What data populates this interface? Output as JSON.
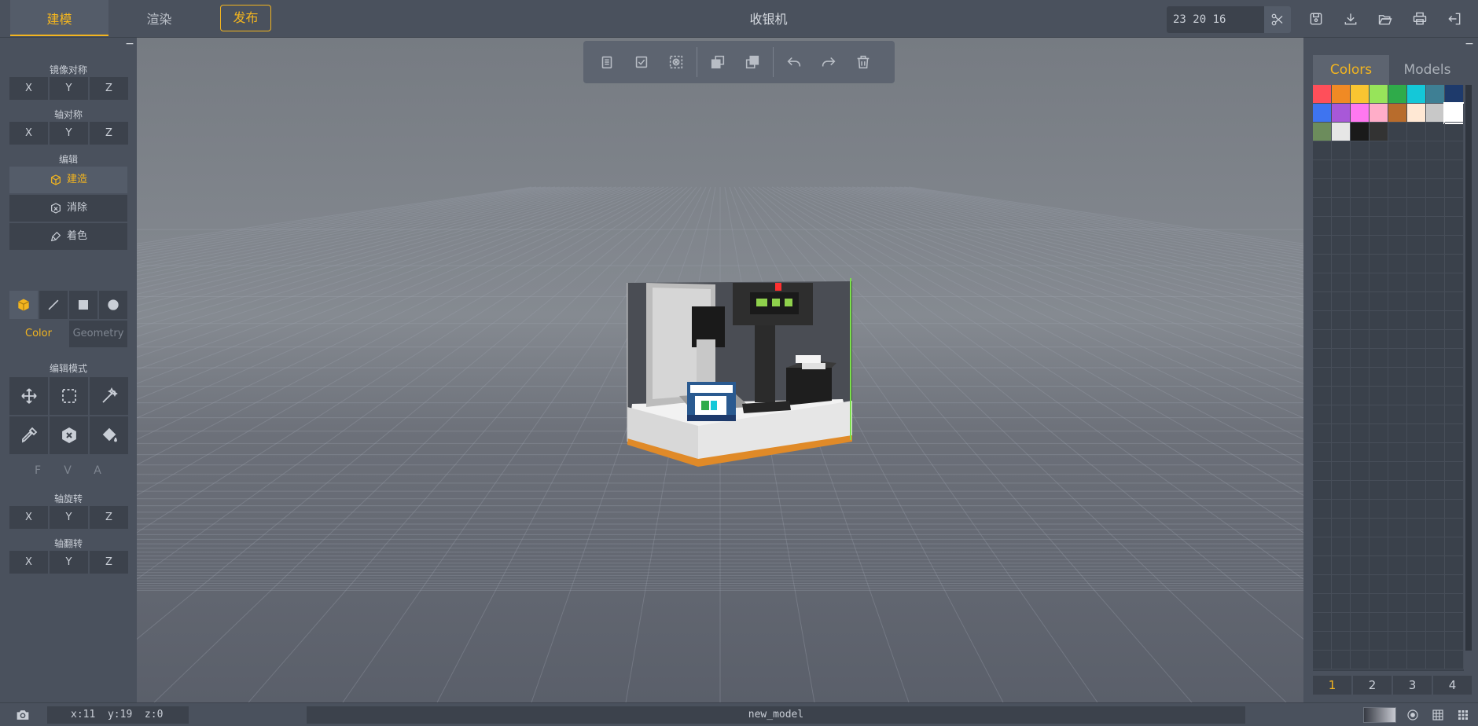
{
  "header": {
    "tabs": [
      {
        "label": "建模",
        "active": true
      },
      {
        "label": "渲染",
        "active": false
      }
    ],
    "publish_label": "发布",
    "title": "收银机",
    "dimensions_value": "23 20 16",
    "icons": [
      "scissors-icon",
      "save-icon",
      "download-icon",
      "folder-open-icon",
      "print-icon",
      "exit-icon"
    ]
  },
  "left": {
    "mirror_label": "镜像对称",
    "mirror_axes": [
      "X",
      "Y",
      "Z"
    ],
    "axis_sym_label": "轴对称",
    "axis_sym_axes": [
      "X",
      "Y",
      "Z"
    ],
    "edit_label": "编辑",
    "tools": [
      {
        "label": "建造",
        "icon": "build-icon",
        "active": true
      },
      {
        "label": "消除",
        "icon": "erase-icon",
        "active": false
      },
      {
        "label": "着色",
        "icon": "paint-brush-icon",
        "active": false
      }
    ],
    "shapes": [
      "cube-icon",
      "line-icon",
      "square-icon",
      "circle-icon"
    ],
    "mode_tabs": [
      {
        "label": "Color",
        "active": true
      },
      {
        "label": "Geometry",
        "active": false
      }
    ],
    "edit_mode_label": "编辑模式",
    "edit_modes_row1": [
      "move-icon",
      "select-box-icon",
      "magic-wand-icon"
    ],
    "edit_modes_row2": [
      "eyedropper-icon",
      "delete-hex-icon",
      "fill-bucket-icon"
    ],
    "fva": [
      "F",
      "V",
      "A"
    ],
    "rotate_label": "轴旋转",
    "rotate_axes": [
      "X",
      "Y",
      "Z"
    ],
    "flip_label": "轴翻转",
    "flip_axes": [
      "X",
      "Y",
      "Z"
    ]
  },
  "toolbar": {
    "group1": [
      "copy-icon",
      "paste-check-icon",
      "clear-selection-icon"
    ],
    "group2": [
      "union-icon",
      "subtract-icon"
    ],
    "group3": [
      "undo-icon",
      "redo-icon",
      "trash-icon"
    ]
  },
  "right": {
    "tabs": [
      {
        "label": "Colors",
        "active": true
      },
      {
        "label": "Models",
        "active": false
      }
    ],
    "colors": [
      "#ff4f5a",
      "#f08a24",
      "#f9c531",
      "#97e45a",
      "#2fab4a",
      "#14c8d8",
      "#3e7f94",
      "#1e3a6b",
      "#3e74f0",
      "#a858d8",
      "#ff78f0",
      "#ffadc8",
      "#b86c2c",
      "#ffe8d4",
      "#c8c8c8",
      "#ffffff",
      "#6c8c5c",
      "#e6e6e6",
      "#1a1a1a",
      "#333333"
    ],
    "selected_color": "#ffffff",
    "pages": [
      {
        "label": "1",
        "active": true
      },
      {
        "label": "2",
        "active": false
      },
      {
        "label": "3",
        "active": false
      },
      {
        "label": "4",
        "active": false
      }
    ]
  },
  "status": {
    "coords": "x:11  y:19  z:0",
    "model_name": "new_model",
    "icons": [
      "camera-icon",
      "background-swatch",
      "target-icon",
      "grid-icon",
      "grid-dense-icon"
    ]
  }
}
